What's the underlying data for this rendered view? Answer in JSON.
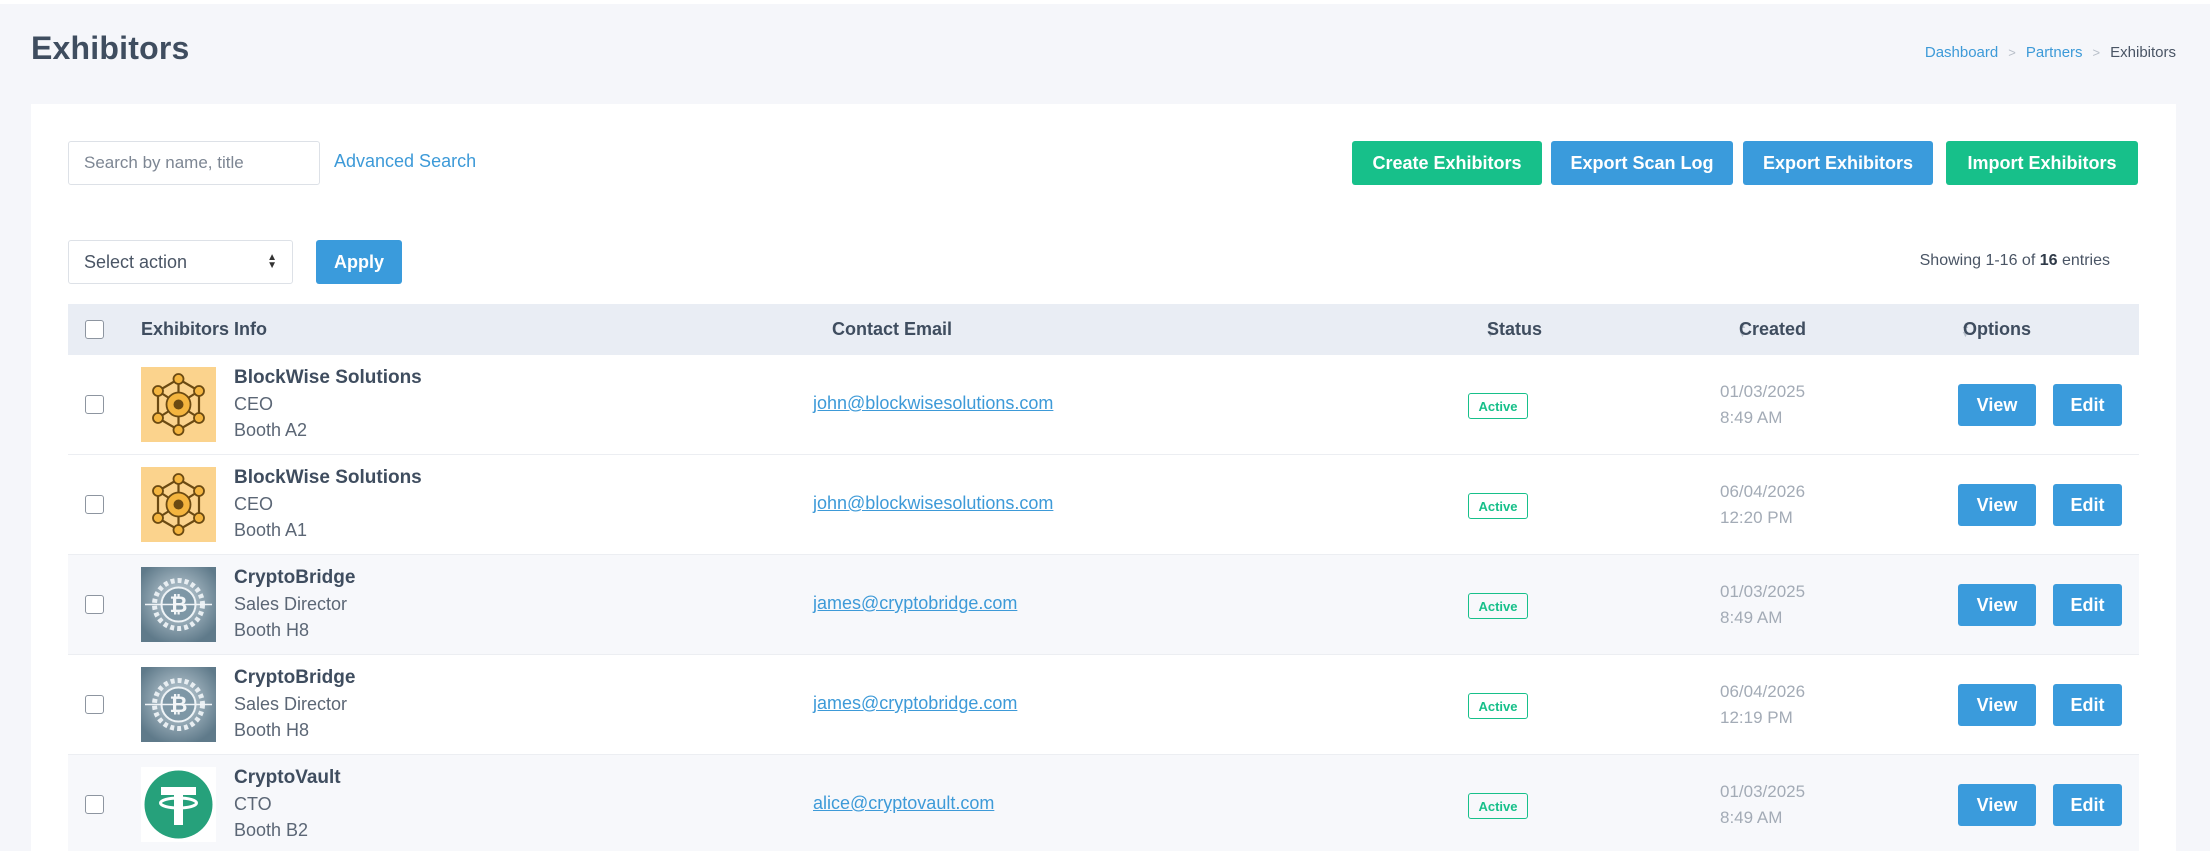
{
  "page": {
    "title": "Exhibitors"
  },
  "breadcrumb": {
    "items": [
      "Dashboard",
      "Partners"
    ],
    "current": "Exhibitors",
    "separator": ">"
  },
  "toolbar": {
    "search_placeholder": "Search by name, title",
    "advanced_search": "Advanced Search",
    "create": "Create Exhibitors",
    "export_scan_log": "Export Scan Log",
    "export": "Export Exhibitors",
    "import": "Import Exhibitors",
    "select_action": "Select action",
    "apply": "Apply",
    "entries_prefix": "Showing 1-16 of",
    "entries_total": "16",
    "entries_suffix": "entries"
  },
  "table": {
    "columns": {
      "info": "Exhibitors Info",
      "email": "Contact Email",
      "status": "Status",
      "created": "Created",
      "options": "Options"
    },
    "view_label": "View",
    "edit_label": "Edit",
    "rows": [
      {
        "company": "BlockWise Solutions",
        "role": "CEO",
        "booth": "Booth A2",
        "email": "john@blockwisesolutions.com",
        "status": "Active",
        "date": "01/03/2025",
        "time": "8:49 AM",
        "logo": "blockchain-network-icon"
      },
      {
        "company": "BlockWise Solutions",
        "role": "CEO",
        "booth": "Booth A1",
        "email": "john@blockwisesolutions.com",
        "status": "Active",
        "date": "06/04/2026",
        "time": "12:20 PM",
        "logo": "blockchain-network-icon"
      },
      {
        "company": "CryptoBridge",
        "role": "Sales Director",
        "booth": "Booth H8",
        "email": "james@cryptobridge.com",
        "status": "Active",
        "date": "01/03/2025",
        "time": "8:49 AM",
        "logo": "bitcoin-gear-icon"
      },
      {
        "company": "CryptoBridge",
        "role": "Sales Director",
        "booth": "Booth H8",
        "email": "james@cryptobridge.com",
        "status": "Active",
        "date": "06/04/2026",
        "time": "12:19 PM",
        "logo": "bitcoin-gear-icon"
      },
      {
        "company": "CryptoVault",
        "role": "CTO",
        "booth": "Booth B2",
        "email": "alice@cryptovault.com",
        "status": "Active",
        "date": "01/03/2025",
        "time": "8:49 AM",
        "logo": "tether-icon"
      }
    ]
  },
  "colors": {
    "accent_blue": "#3a9bdc",
    "accent_green": "#17c08a",
    "header_bg": "#e9edf4",
    "page_bg": "#f5f6fa"
  }
}
